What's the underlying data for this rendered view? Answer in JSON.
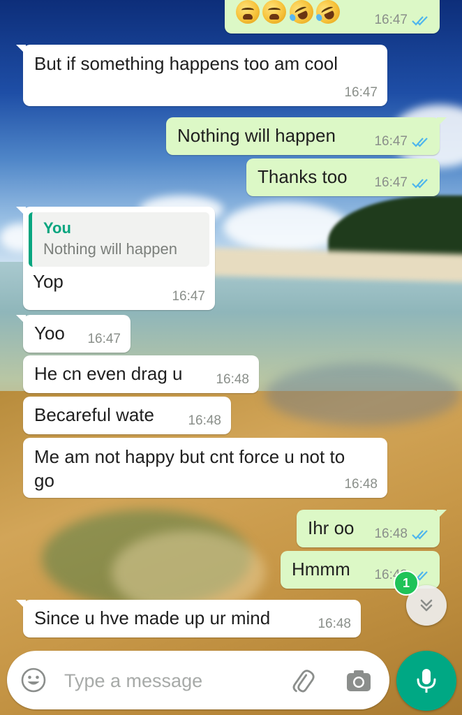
{
  "colors": {
    "incoming_bubble": "#ffffff",
    "outgoing_bubble": "#dcf8c6",
    "read_tick": "#4fb6ec",
    "quote_accent": "#06a57f",
    "send_button": "#00a884",
    "unread_badge": "#1fc358"
  },
  "messages": [
    {
      "direction": "outgoing",
      "text": "",
      "emojis": [
        "weary-face",
        "weary-face",
        "rolling-on-floor-laughing",
        "rolling-on-floor-laughing"
      ],
      "time": "16:47",
      "status": "read"
    },
    {
      "direction": "incoming",
      "text": "But if something happens too am cool",
      "time": "16:47"
    },
    {
      "direction": "outgoing",
      "text": "Nothing will happen",
      "time": "16:47",
      "status": "read"
    },
    {
      "direction": "outgoing",
      "text": "Thanks too",
      "time": "16:47",
      "status": "read"
    },
    {
      "direction": "incoming",
      "quote": {
        "author": "You",
        "text": "Nothing will happen"
      },
      "text": "Yop",
      "time": "16:47"
    },
    {
      "direction": "incoming",
      "text": "Yoo",
      "time": "16:47"
    },
    {
      "direction": "incoming",
      "text": "He cn even drag u",
      "time": "16:48"
    },
    {
      "direction": "incoming",
      "text": "Becareful wate",
      "time": "16:48"
    },
    {
      "direction": "incoming",
      "text": "Me am not happy but cnt force u not to go",
      "time": "16:48"
    },
    {
      "direction": "outgoing",
      "text": "Ihr oo",
      "time": "16:48",
      "status": "read"
    },
    {
      "direction": "outgoing",
      "text": "Hmmm",
      "time": "16:48",
      "status": "read"
    },
    {
      "direction": "incoming",
      "text": "Since u hve made up ur mind",
      "time": "16:48"
    }
  ],
  "scroll_button": {
    "icon": "double-chevron-down-icon",
    "unread_count": "1"
  },
  "composer": {
    "placeholder": "Type a message",
    "emoji_icon": "emoji-icon",
    "attach_icon": "paperclip-icon",
    "camera_icon": "camera-icon",
    "mic_icon": "mic-icon"
  }
}
